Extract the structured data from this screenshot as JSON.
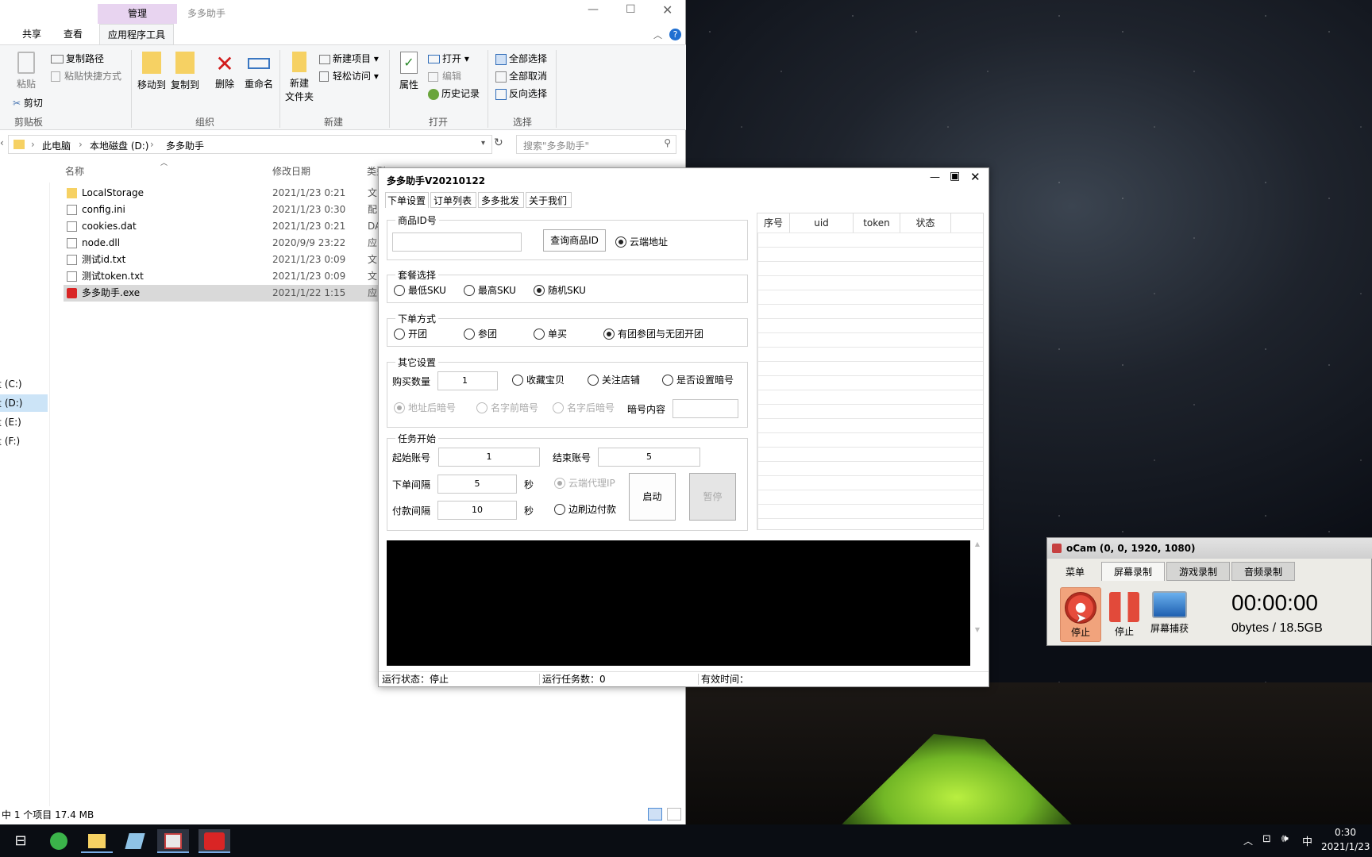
{
  "explorer": {
    "title_context": "管理",
    "title": "多多助手",
    "tabs": [
      "共享",
      "查看",
      "应用程序工具"
    ],
    "ribbon": {
      "clipboard": {
        "copy_path": "复制路径",
        "paste_shortcut": "粘贴快捷方式",
        "paste": "粘贴",
        "cut": "剪切",
        "group": "剪贴板"
      },
      "organize": {
        "move_to": "移动到",
        "copy_to": "复制到",
        "delete": "删除",
        "rename": "重命名",
        "group": "组织"
      },
      "new": {
        "new_folder_l1": "新建",
        "new_folder_l2": "文件夹",
        "new_item": "新建项目",
        "easy_access": "轻松访问",
        "group": "新建"
      },
      "open": {
        "properties": "属性",
        "open": "打开",
        "edit": "编辑",
        "history": "历史记录",
        "group": "打开"
      },
      "select": {
        "select_all": "全部选择",
        "select_none": "全部取消",
        "invert": "反向选择",
        "group": "选择"
      }
    },
    "address": [
      "此电脑",
      "本地磁盘 (D:)",
      "多多助手"
    ],
    "search_placeholder": "搜索\"多多助手\"",
    "columns": {
      "name": "名称",
      "date": "修改日期",
      "type": "类型"
    },
    "files": [
      {
        "name": "LocalStorage",
        "date": "2021/1/23 0:21",
        "type": "文"
      },
      {
        "name": "config.ini",
        "date": "2021/1/23 0:30",
        "type": "配"
      },
      {
        "name": "cookies.dat",
        "date": "2021/1/23 0:21",
        "type": "DA"
      },
      {
        "name": "node.dll",
        "date": "2020/9/9 23:22",
        "type": "应"
      },
      {
        "name": "测试id.txt",
        "date": "2021/1/23 0:09",
        "type": "文"
      },
      {
        "name": "测试token.txt",
        "date": "2021/1/23 0:09",
        "type": "文"
      },
      {
        "name": "多多助手.exe",
        "date": "2021/1/22 1:15",
        "type": "应"
      }
    ],
    "drives": [
      "盘 (C:)",
      "盘 (D:)",
      "盘 (E:)",
      "盘 (F:)"
    ],
    "status": "中 1 个项目  17.4 MB"
  },
  "app": {
    "title": "多多助手V20210122",
    "tabs": [
      "下单设置",
      "订单列表",
      "多多批发",
      "关于我们"
    ],
    "product": {
      "legend": "商品ID号",
      "value": "",
      "query_btn": "查询商品ID",
      "cloud": "云端地址"
    },
    "package": {
      "legend": "套餐选择",
      "opts": [
        "最低SKU",
        "最高SKU",
        "随机SKU"
      ]
    },
    "order_mode": {
      "legend": "下单方式",
      "opts": [
        "开团",
        "参团",
        "单买",
        "有团参团与无团开团"
      ]
    },
    "other": {
      "legend": "其它设置",
      "qty_label": "购买数量",
      "qty": "1",
      "fav": "收藏宝贝",
      "follow": "关注店铺",
      "set_code": "是否设置暗号",
      "after_addr": "地址后暗号",
      "before_name": "名字前暗号",
      "after_name": "名字后暗号",
      "code_label": "暗号内容",
      "code_value": ""
    },
    "task": {
      "legend": "任务开始",
      "start_label": "起始账号",
      "start": "1",
      "end_label": "结束账号",
      "end": "5",
      "order_int_label": "下单间隔",
      "order_int": "5",
      "pay_int_label": "付款间隔",
      "pay_int": "10",
      "sec": "秒",
      "proxy": "云端代理IP",
      "pay_while": "边刷边付款",
      "start_btn": "启动",
      "pause_btn": "暂停"
    },
    "grid_cols": [
      "序号",
      "uid",
      "token",
      "状态"
    ],
    "status": {
      "run_state": "运行状态：停止",
      "task_count": "运行任务数：0",
      "valid_time": "有效时间："
    }
  },
  "ocam": {
    "title": "oCam (0, 0, 1920, 1080)",
    "tabs": [
      "菜单",
      "屏幕录制",
      "游戏录制",
      "音频录制"
    ],
    "record": "停止",
    "stop": "停止",
    "capture": "屏幕捕获",
    "timer": "00:00:00",
    "size": "0bytes / 18.5GB"
  },
  "taskbar": {
    "time": "0:30",
    "date": "2021/1/23",
    "ime": "中"
  }
}
